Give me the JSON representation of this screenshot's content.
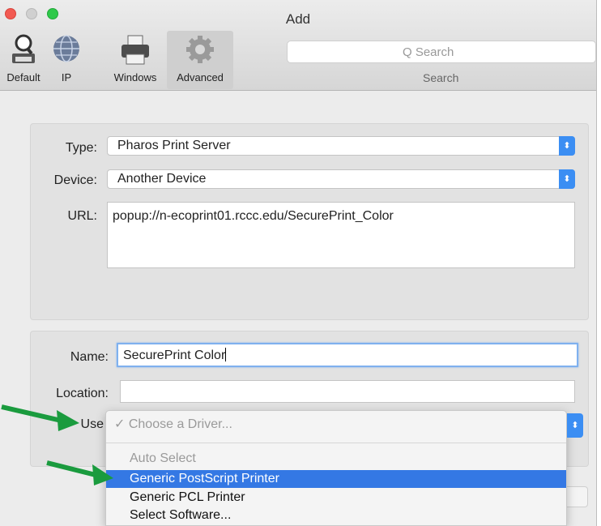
{
  "window": {
    "title": "Add"
  },
  "toolbar": {
    "tabs": [
      {
        "label": "Default",
        "icon": "magnifier-printer-icon"
      },
      {
        "label": "IP",
        "icon": "globe-icon"
      },
      {
        "label": "Windows",
        "icon": "printer-icon"
      },
      {
        "label": "Advanced",
        "icon": "gear-icon",
        "selected": true
      }
    ],
    "search": {
      "placeholder": "Q Search",
      "caption": "Search"
    }
  },
  "form": {
    "type": {
      "label": "Type:",
      "value": "Pharos Print Server"
    },
    "device": {
      "label": "Device:",
      "value": "Another Device"
    },
    "url": {
      "label": "URL:",
      "value": "popup://n-ecoprint01.rccc.edu/SecurePrint_Color"
    },
    "name": {
      "label": "Name:",
      "value": "SecurePrint Color"
    },
    "location": {
      "label": "Location:",
      "value": ""
    },
    "use": {
      "label": "Use"
    }
  },
  "driver_menu": {
    "checked_item": "✓ Choose a Driver...",
    "items": [
      "Auto Select",
      "Generic PostScript Printer",
      "Generic PCL Printer",
      "Select Software..."
    ],
    "highlighted": "Generic PostScript Printer"
  },
  "colors": {
    "accent": "#3478e4",
    "arrow": "#1a9b3e",
    "focus_ring": "#7fb1ef"
  }
}
